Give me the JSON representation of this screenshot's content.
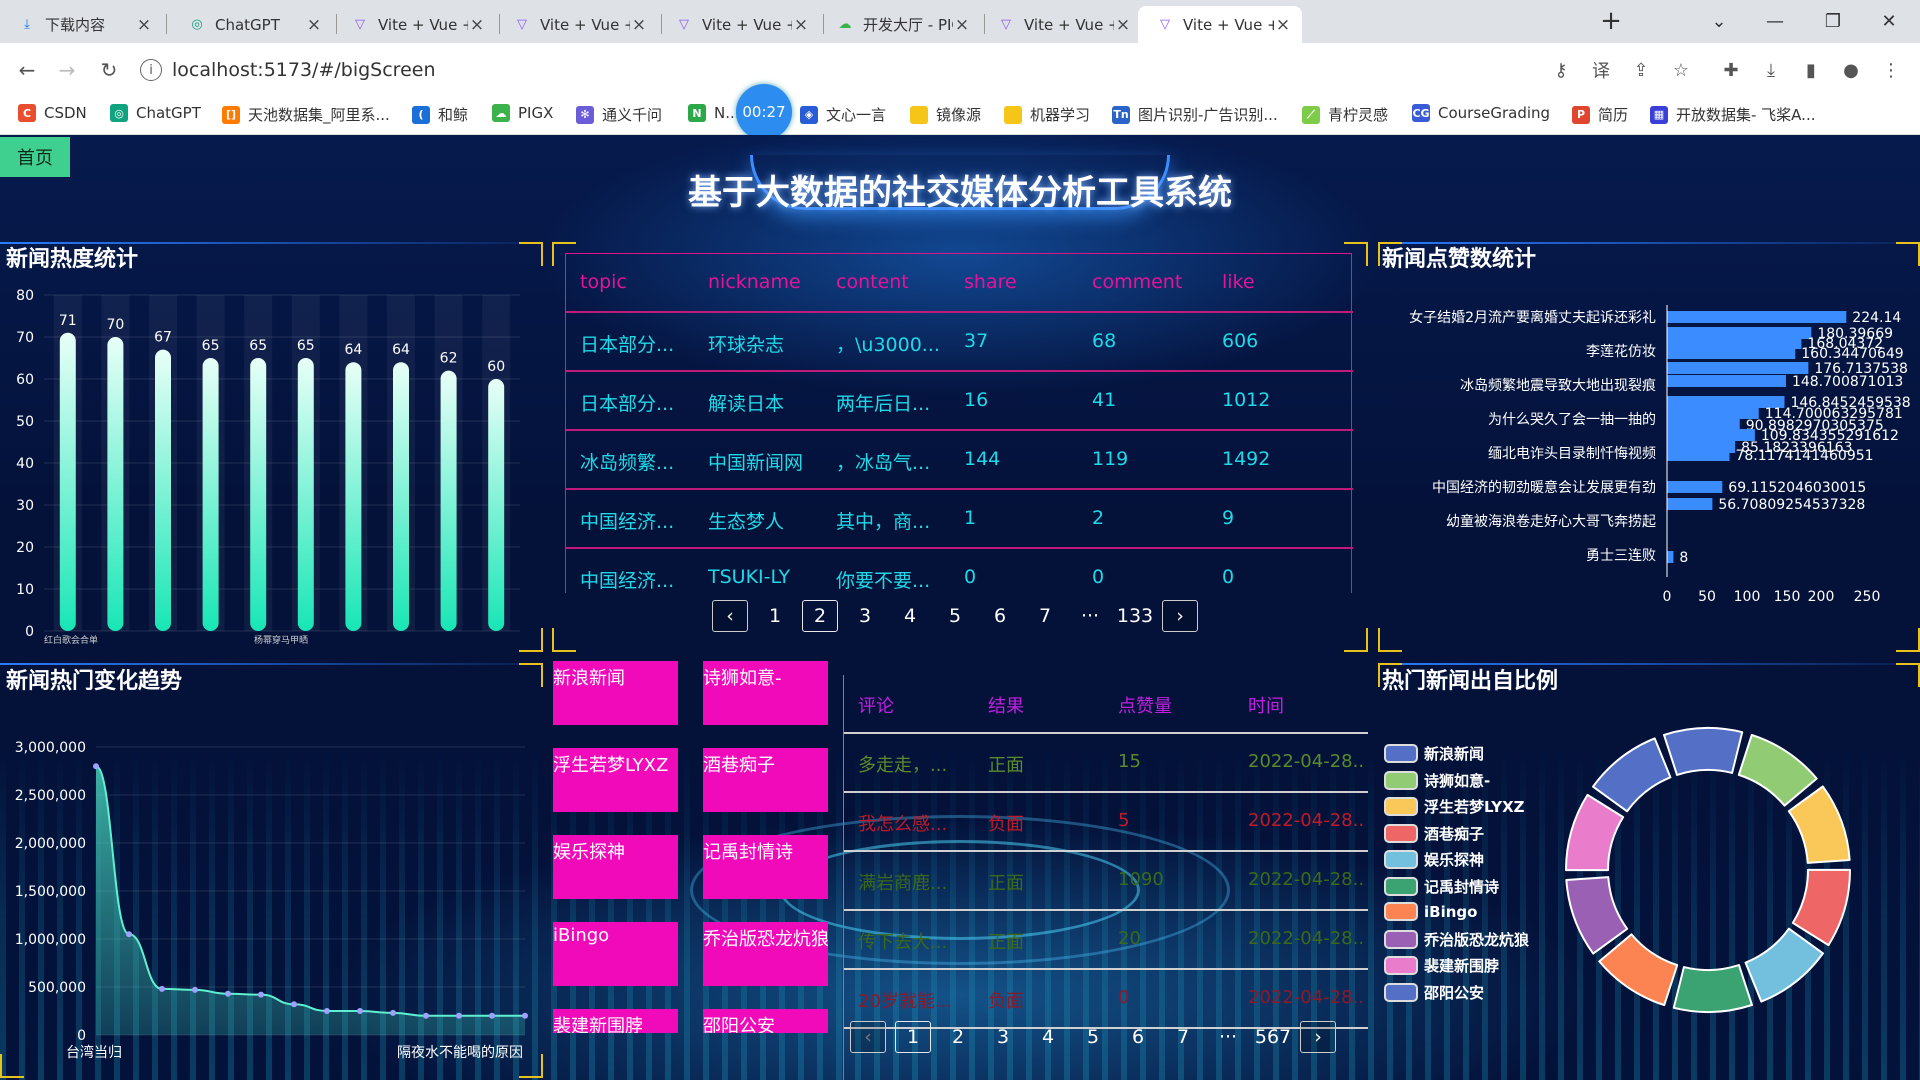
{
  "browser": {
    "tabs": [
      {
        "label": "下载内容",
        "icon": "download-icon",
        "color": "#1a73e8"
      },
      {
        "label": "ChatGPT",
        "icon": "chatgpt-icon",
        "color": "#10a37f"
      },
      {
        "label": "Vite + Vue + TS",
        "icon": "vite-icon",
        "color": "#8b5cf6"
      },
      {
        "label": "Vite + Vue + TS",
        "icon": "vite-icon",
        "color": "#8b5cf6"
      },
      {
        "label": "Vite + Vue + TS",
        "icon": "vite-icon",
        "color": "#8b5cf6"
      },
      {
        "label": "开发大厅 - PIGX",
        "icon": "cloud-icon",
        "color": "#3bb24a"
      },
      {
        "label": "Vite + Vue + TS",
        "icon": "vite-icon",
        "color": "#8b5cf6"
      },
      {
        "label": "Vite + Vue + TS",
        "icon": "vite-icon",
        "color": "#8b5cf6"
      }
    ],
    "url": "localhost:5173/#/bigScreen",
    "bookmarks": [
      {
        "label": "CSDN",
        "color": "#e94e2e",
        "glyph": "C"
      },
      {
        "label": "ChatGPT",
        "color": "#10a37f",
        "glyph": "◎"
      },
      {
        "label": "天池数据集_阿里系...",
        "color": "#ff7a00",
        "glyph": "[]"
      },
      {
        "label": "和鲸",
        "color": "#1a6fd8",
        "glyph": "("
      },
      {
        "label": "PIGX",
        "color": "#3bb24a",
        "glyph": "☁"
      },
      {
        "label": "通义千问",
        "color": "#6b5cd8",
        "glyph": "✻"
      },
      {
        "label": "N...",
        "color": "#2aa84a",
        "glyph": "N"
      },
      {
        "label": "文心一言",
        "color": "#2a5bd7",
        "glyph": "◈"
      },
      {
        "label": "镜像源",
        "color": "#f5c518",
        "glyph": ""
      },
      {
        "label": "机器学习",
        "color": "#f5c518",
        "glyph": ""
      },
      {
        "label": "图片识别-广告识别...",
        "color": "#2a64c8",
        "glyph": "Tn"
      },
      {
        "label": "青柠灵感",
        "color": "#7ecb4a",
        "glyph": "⟋"
      },
      {
        "label": "CourseGrading",
        "color": "#3a5bd8",
        "glyph": "CG"
      },
      {
        "label": "简历",
        "color": "#e0452f",
        "glyph": "P"
      },
      {
        "label": "开放数据集- 飞桨A...",
        "color": "#3a3fd8",
        "glyph": "▦"
      }
    ],
    "timer": "00:27"
  },
  "dashboard": {
    "home_label": "首页",
    "title": "基于大数据的社交媒体分析工具系统",
    "panels": {
      "heat": "新闻热度统计",
      "likes": "新闻点赞数统计",
      "trend": "新闻热门变化趋势",
      "ratio": "热门新闻出自比例"
    },
    "news_table": {
      "headers": [
        "topic",
        "nickname",
        "content",
        "share",
        "comment",
        "like"
      ],
      "rows": [
        [
          "日本部分...",
          "环球杂志",
          "，\\u3000...",
          "37",
          "68",
          "606"
        ],
        [
          "日本部分...",
          "解读日本",
          "两年后日...",
          "16",
          "41",
          "1012"
        ],
        [
          "冰岛频繁...",
          "中国新闻网",
          "，冰岛气...",
          "144",
          "119",
          "1492"
        ],
        [
          "中国经济...",
          "生态梦人",
          "其中，商...",
          "1",
          "2",
          "9"
        ],
        [
          "中国经济...",
          "TSUKI-LY",
          "你要不要...",
          "0",
          "0",
          "0"
        ]
      ],
      "pager": {
        "prev": "‹",
        "pages": [
          "1",
          "2",
          "3",
          "4",
          "5",
          "6",
          "7",
          "···",
          "133"
        ],
        "current": "2",
        "next": "›"
      }
    },
    "source_tiles": [
      "新浪新闻",
      "诗狮如意-",
      "浮生若梦LYXZ",
      "酒巷痴子",
      "娱乐探神",
      "记禹封情诗",
      "iBingo",
      "乔治版恐龙炕狼",
      "裴建新围脖",
      "邵阳公安"
    ],
    "comment_table": {
      "headers": [
        "评论",
        "结果",
        "点赞量",
        "时间"
      ],
      "rows": [
        {
          "cells": [
            "多走走，...",
            "正面",
            "15",
            "2022-04-28..."
          ],
          "color": "#5a8a2a"
        },
        {
          "cells": [
            "我怎么感...",
            "负面",
            "5",
            "2022-04-28..."
          ],
          "color": "#c01a2a"
        },
        {
          "cells": [
            "满岩商鹿...",
            "正面",
            "1090",
            "2022-04-28..."
          ],
          "color": "#3a6a1a"
        },
        {
          "cells": [
            "传下去大...",
            "正面",
            "20",
            "2022-04-28..."
          ],
          "color": "#3a6a1a"
        },
        {
          "cells": [
            "20岁就能...",
            "负面",
            "0",
            "2022-04-28..."
          ],
          "color": "#8a1a2a"
        }
      ],
      "pager": {
        "prev": "‹",
        "pages": [
          "1",
          "2",
          "3",
          "4",
          "5",
          "6",
          "7",
          "···",
          "567"
        ],
        "current": "1",
        "next": "›"
      }
    },
    "ratio_legend": [
      {
        "label": "新浪新闻",
        "color": "#5470c6"
      },
      {
        "label": "诗狮如意-",
        "color": "#91cc75"
      },
      {
        "label": "浮生若梦LYXZ",
        "color": "#fac858"
      },
      {
        "label": "酒巷痴子",
        "color": "#ee6666"
      },
      {
        "label": "娱乐探神",
        "color": "#73c0de"
      },
      {
        "label": "记禹封情诗",
        "color": "#3ba272"
      },
      {
        "label": "iBingo",
        "color": "#fc8452"
      },
      {
        "label": "乔治版恐龙炕狼",
        "color": "#9a60b4"
      },
      {
        "label": "裴建新围脖",
        "color": "#ea7ccc"
      },
      {
        "label": "邵阳公安",
        "color": "#5470c6"
      }
    ]
  },
  "chart_data": [
    {
      "type": "bar",
      "values": [
        71,
        70,
        67,
        65,
        65,
        65,
        64,
        64,
        62,
        60
      ],
      "tick_labels": [
        "红白歌会合单",
        "杨幂穿马甲晒"
      ],
      "ylim": [
        0,
        80
      ],
      "yticks": [
        0,
        10,
        20,
        30,
        40,
        50,
        60,
        70,
        80
      ]
    },
    {
      "type": "bar",
      "orientation": "horizontal",
      "categories": [
        "女子结婚2月流产要离婚丈夫起诉还彩礼",
        "李莲花仿妆",
        "冰岛频繁地震导致大地出现裂痕",
        "为什么哭久了会一抽一抽的",
        "缅北电诈头目录制忏悔视频",
        "中国经济的韧劲暖意会让发展更有劲",
        "幼童被海浪卷走好心大哥飞奔捞起",
        "勇士三连败"
      ],
      "values": [
        224.14,
        180.3966,
        168.0437,
        160.3447,
        176.7137,
        148.7008,
        146.8452,
        114.7,
        90.8983,
        109.8343,
        85.1823,
        78.1174,
        69.1152046030015,
        56.70809254537328,
        8
      ],
      "value_labels": [
        "224.14",
        "180.39669",
        "168.04372",
        "160.34470649",
        "176.7137538",
        "148.700871013",
        "146.8452459538",
        "114.700063295781",
        "90.8982970305375",
        "109.834355291612",
        "85.1823396163",
        "78.1174141460951",
        "69.1152046030015",
        "56.70809254537328",
        "8"
      ],
      "xlim": [
        0,
        250
      ],
      "xticks": [
        "0",
        "50",
        "100",
        "150",
        "200",
        "250"
      ]
    },
    {
      "type": "area",
      "values": [
        2800000,
        1050000,
        480000,
        470000,
        430000,
        420000,
        320000,
        250000,
        250000,
        230000,
        200000,
        200000,
        200000,
        200000
      ],
      "yticks": [
        "0",
        "500,000",
        "1,000,000",
        "1,500,000",
        "2,000,000",
        "2,500,000",
        "3,000,000"
      ],
      "ylim": [
        0,
        3000000
      ],
      "tick_labels": [
        "台湾当归",
        "隔夜水不能喝的原因"
      ]
    },
    {
      "type": "pie",
      "donut": true,
      "values": [
        1,
        1,
        1,
        1,
        1,
        1,
        1,
        1,
        1,
        1
      ],
      "colors": [
        "#5470c6",
        "#91cc75",
        "#fac858",
        "#ee6666",
        "#73c0de",
        "#3ba272",
        "#fc8452",
        "#9a60b4",
        "#ea7ccc",
        "#5470c6"
      ]
    }
  ]
}
